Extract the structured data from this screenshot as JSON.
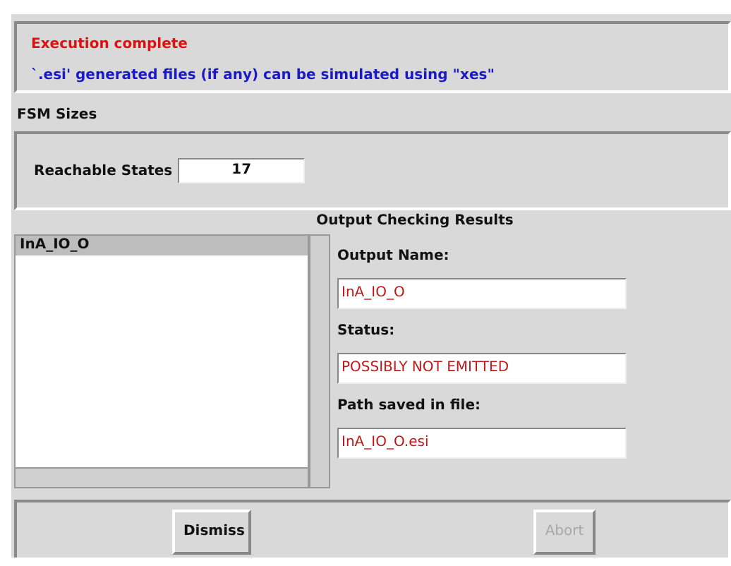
{
  "messages": [
    {
      "kind": "error",
      "text": "Execution complete"
    },
    {
      "kind": "info",
      "text": "`.esi' generated files (if any) can be simulated using \"xes\""
    }
  ],
  "fsm_sizes": {
    "title": "FSM Sizes",
    "fields": [
      {
        "label": "Reachable States",
        "value": "17"
      }
    ]
  },
  "output_checking": {
    "title": "Output Checking Results",
    "list": [
      {
        "label": "InA_IO_O",
        "selected": true
      }
    ],
    "details": [
      {
        "label": "Output Name:",
        "value": "InA_IO_O"
      },
      {
        "label": "Status:",
        "value": "POSSIBLY NOT EMITTED"
      },
      {
        "label": "Path saved in file:",
        "value": "InA_IO_O.esi"
      }
    ]
  },
  "buttons": [
    {
      "label": "Dismiss",
      "disabled": false
    },
    {
      "label": "Abort",
      "disabled": true
    }
  ]
}
